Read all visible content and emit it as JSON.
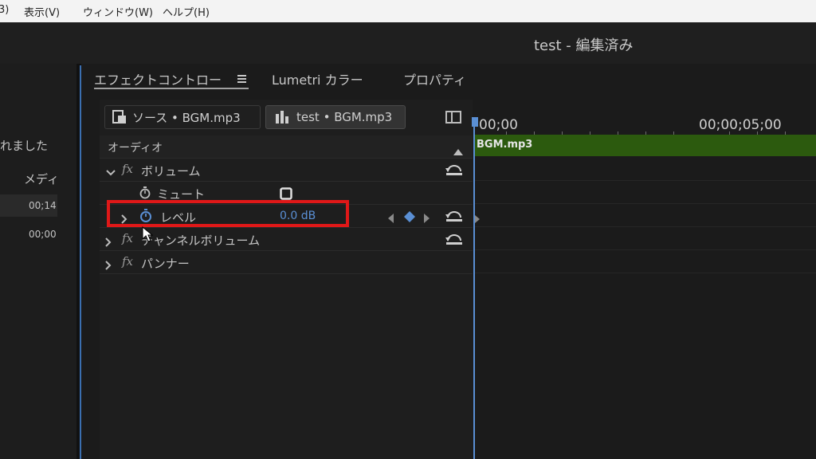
{
  "menubar": {
    "items": [
      "3)",
      "表示(V)",
      "ウィンドウ(W)",
      "ヘルプ(H)"
    ]
  },
  "window": {
    "title": "test - 編集済み"
  },
  "left_panel": {
    "text_message": "れました",
    "text_media": "メディ",
    "rows": [
      "00;14",
      "00;00"
    ]
  },
  "effect_controls": {
    "tabs": [
      "エフェクトコントロー",
      "Lumetri カラー",
      "プロパティ"
    ],
    "menu_icon": "hamburger-icon",
    "clip_tabs": [
      {
        "label": "ソース • BGM.mp3",
        "icon": "source-clip-icon"
      },
      {
        "label": "test • BGM.mp3",
        "icon": "sequence-clip-icon"
      }
    ],
    "section": "オーディオ",
    "effects": {
      "volume": "ボリューム",
      "mute": "ミュート",
      "level": {
        "label": "レベル",
        "value": "0.0 dB"
      },
      "channel_volume": "チャンネルボリューム",
      "panner": "パンナー"
    },
    "fx_label": "fx"
  },
  "timeline": {
    "timecodes": [
      "00;00",
      "00;00;05;00"
    ],
    "clip_name": "BGM.mp3"
  },
  "colors": {
    "highlight": "#e01818",
    "accent_blue": "#5a8fd4",
    "clip_green": "#2c5a0e"
  }
}
